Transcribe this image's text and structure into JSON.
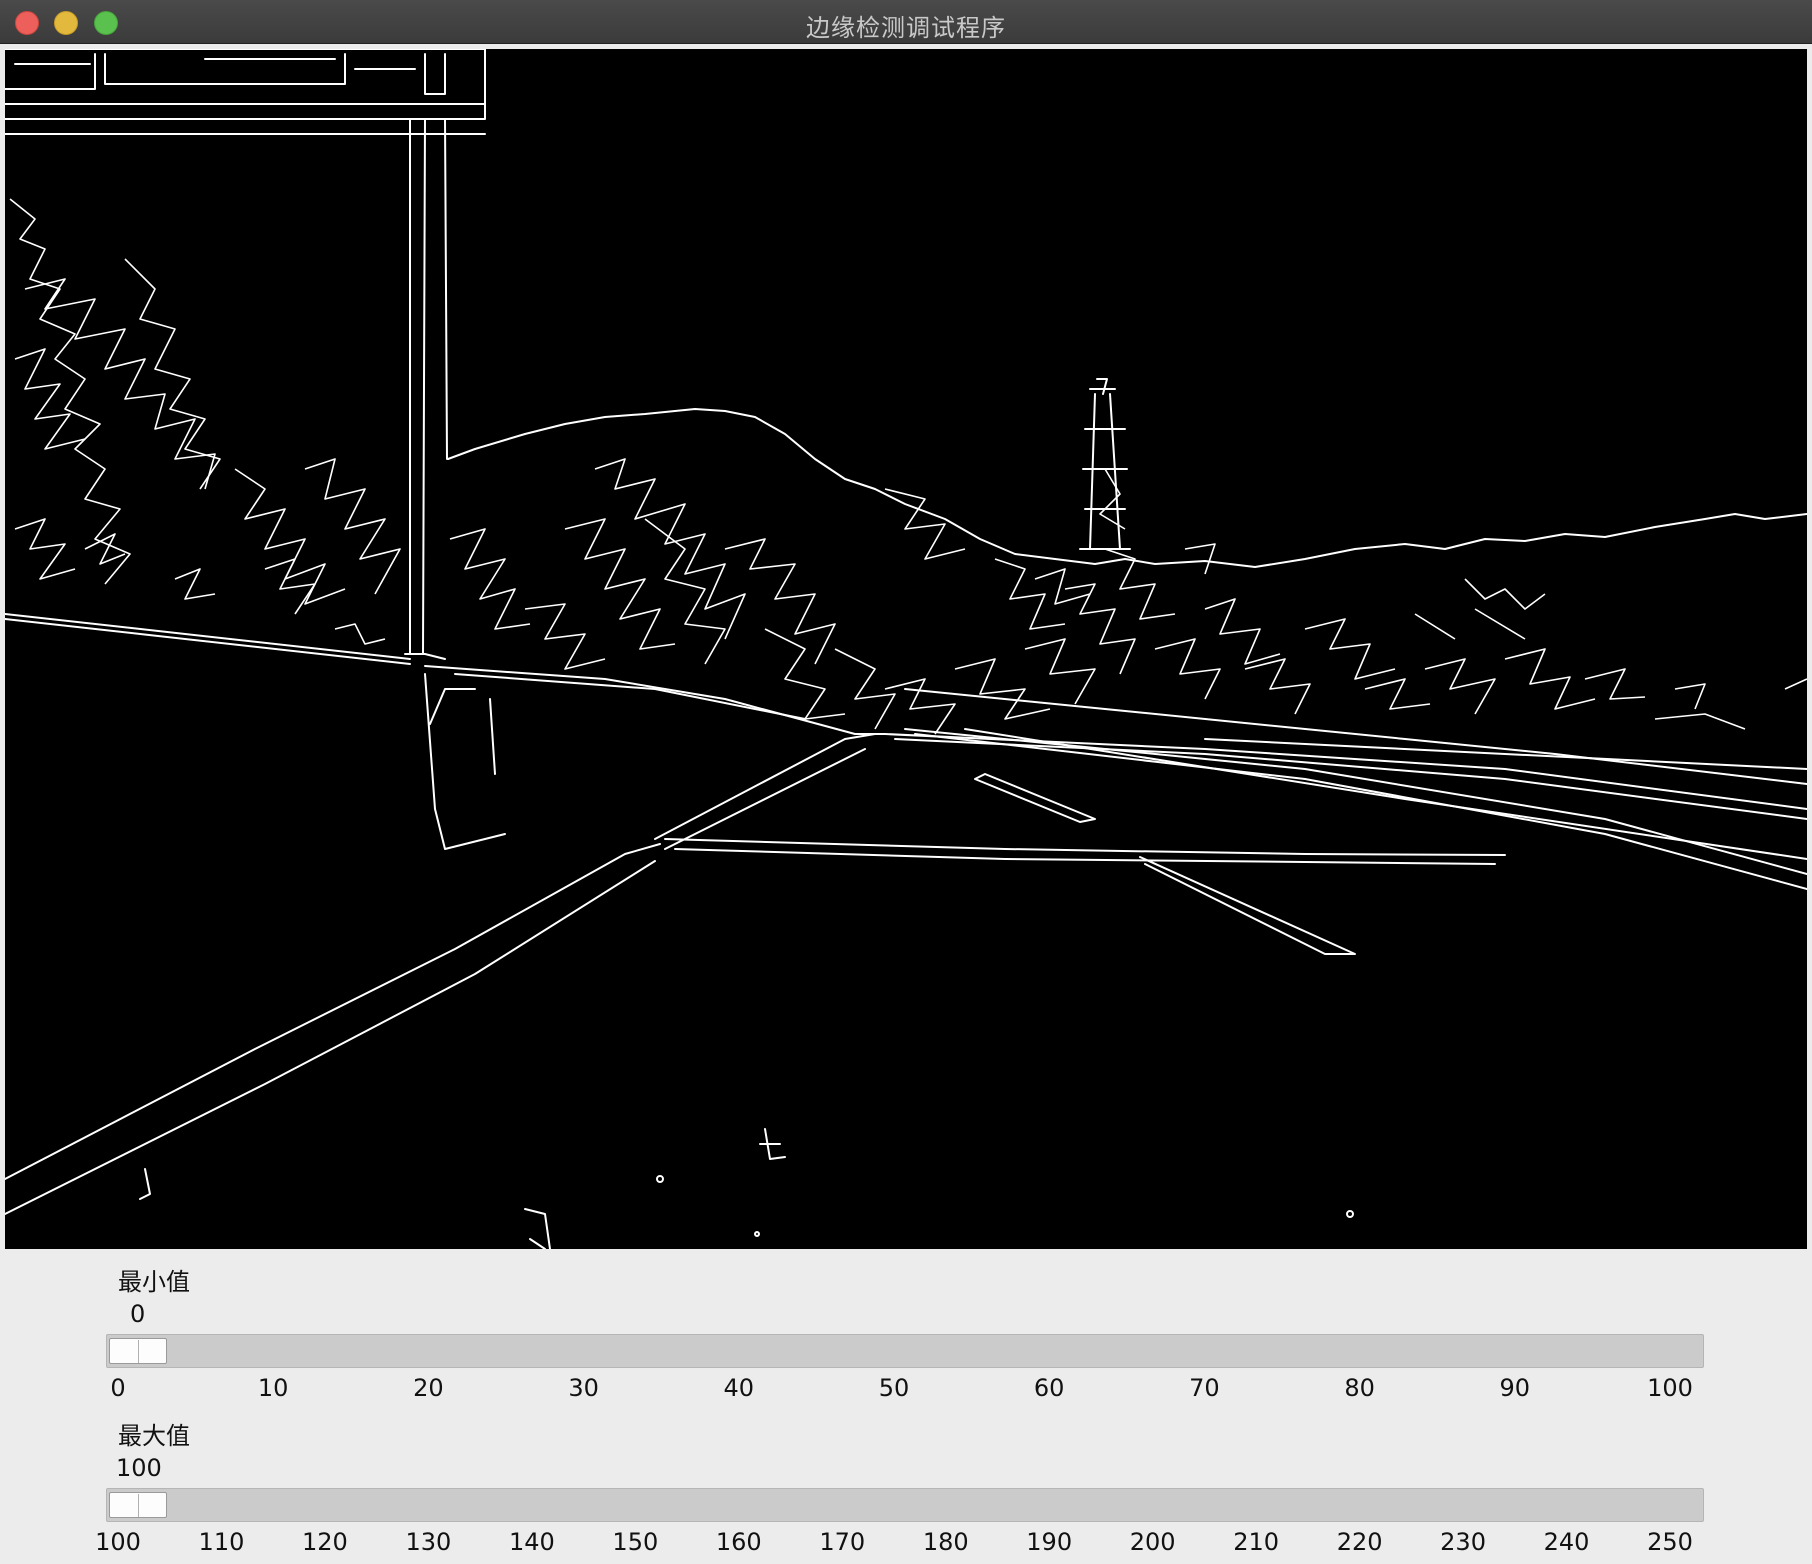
{
  "window": {
    "title": "边缘检测调试程序"
  },
  "image": {
    "content": "edge-detection-output"
  },
  "min_slider": {
    "label": "最小值",
    "value": "0",
    "fraction": 0.0,
    "ticks": [
      "0",
      "10",
      "20",
      "30",
      "40",
      "50",
      "60",
      "70",
      "80",
      "90",
      "100"
    ]
  },
  "max_slider": {
    "label": "最大值",
    "value": "100",
    "fraction": 0.0,
    "ticks": [
      "100",
      "110",
      "120",
      "130",
      "140",
      "150",
      "160",
      "170",
      "180",
      "190",
      "200",
      "210",
      "220",
      "230",
      "240",
      "250"
    ]
  },
  "colors": {
    "edge": "#ffffff",
    "background": "#000000",
    "track": "#cbcbcb"
  }
}
